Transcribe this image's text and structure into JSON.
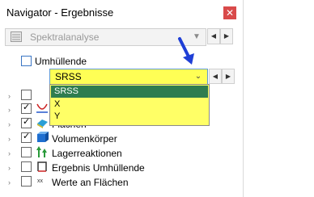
{
  "window": {
    "title": "Navigator - Ergebnisse"
  },
  "header_combo": {
    "value": "Spektralanalyse"
  },
  "envelope": {
    "label": "Umhüllende"
  },
  "combo": {
    "value": "SRSS",
    "options": [
      "SRSS",
      "X",
      "Y"
    ]
  },
  "tree": [
    {
      "label": "",
      "checked": false
    },
    {
      "label": "",
      "checked": true
    },
    {
      "label": "Flächen",
      "checked": true
    },
    {
      "label": "Volumenkörper",
      "checked": true
    },
    {
      "label": "Lagerreaktionen",
      "checked": false
    },
    {
      "label": "Ergebnis Umhüllende",
      "checked": false
    },
    {
      "label": "Werte an Flächen",
      "checked": false
    }
  ],
  "colors": {
    "highlight_yellow": "#ffff55",
    "selection_green": "#2f7d4f",
    "arrow_blue": "#1f3fd6",
    "close_red": "#d94a4a"
  }
}
